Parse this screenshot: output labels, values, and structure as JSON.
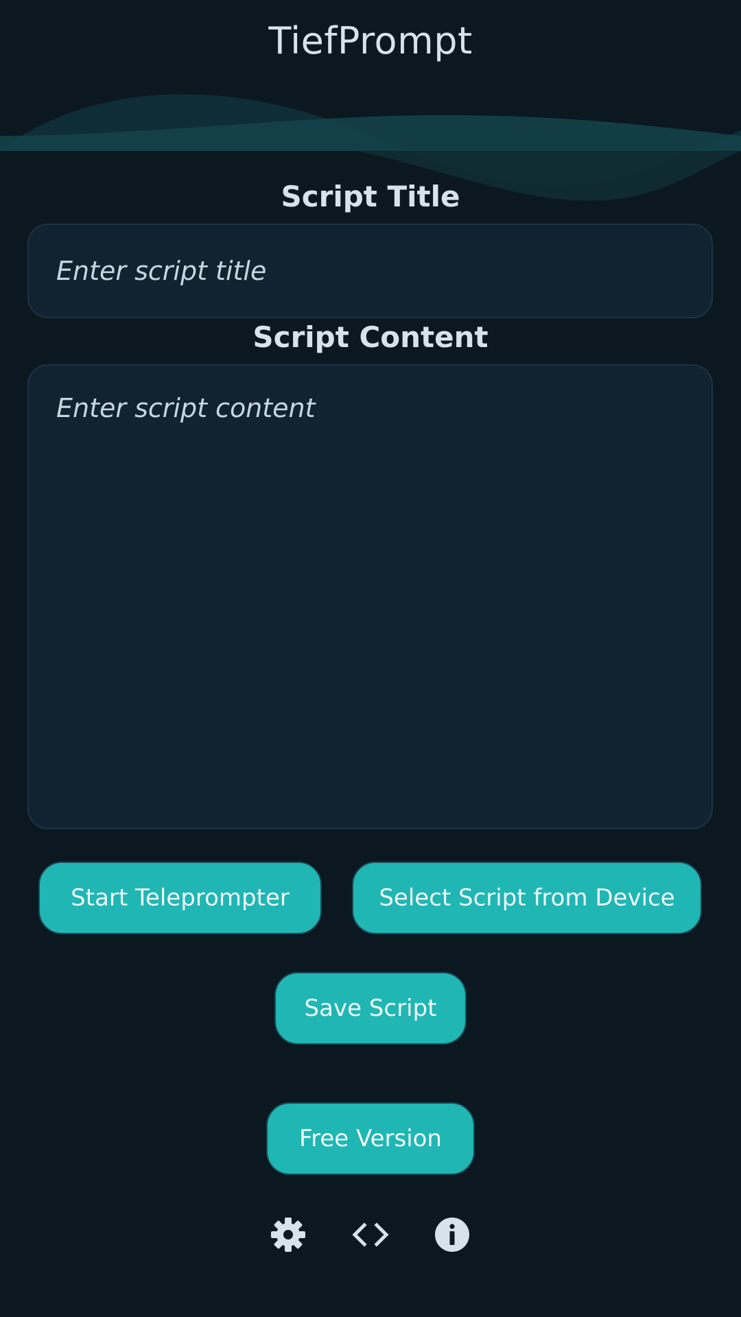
{
  "header": {
    "title": "TiefPrompt"
  },
  "form": {
    "title_label": "Script Title",
    "title_placeholder": "Enter script title",
    "title_value": "",
    "content_label": "Script Content",
    "content_placeholder": "Enter script content",
    "content_value": ""
  },
  "actions": {
    "start_label": "Start Teleprompter",
    "select_label": "Select Script from Device",
    "save_label": "Save Script",
    "free_label": "Free Version"
  },
  "footer_icons": [
    "gear-icon",
    "code-icon",
    "info-icon"
  ],
  "colors": {
    "background": "#0b1820",
    "field_background": "#112230",
    "accent": "#20b6b4",
    "text": "#d6e3ea"
  }
}
